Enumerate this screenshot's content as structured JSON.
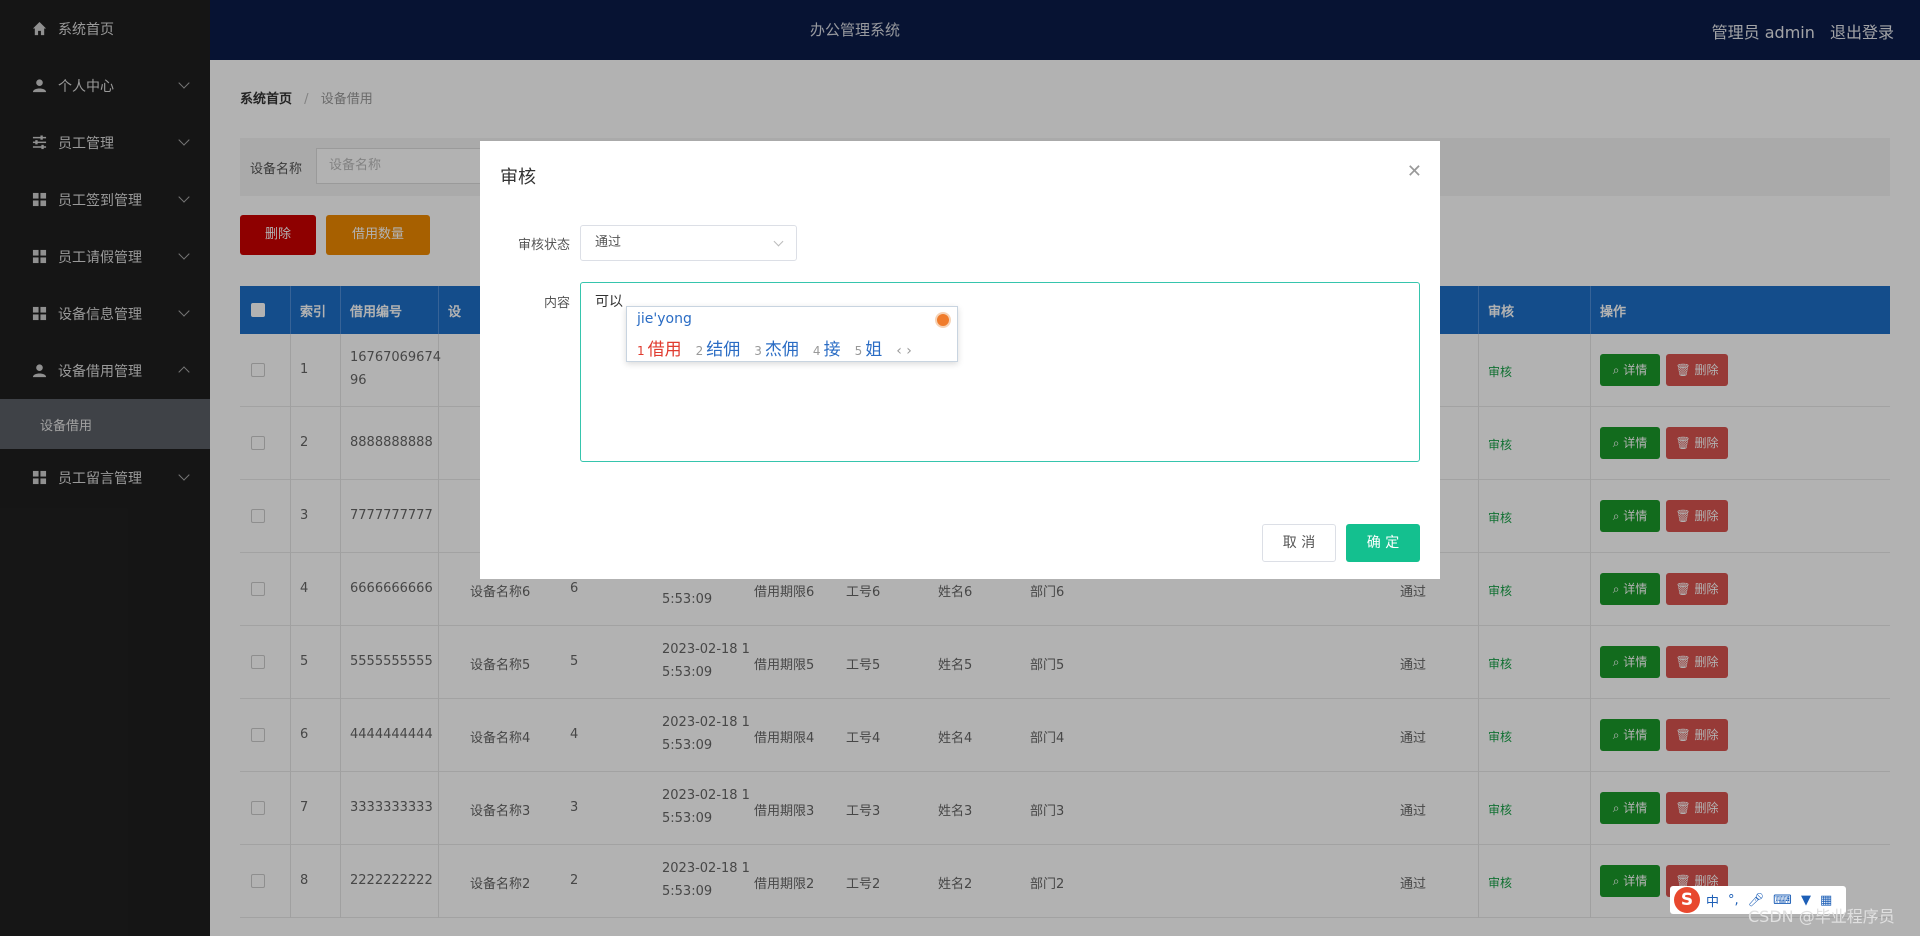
{
  "app": {
    "title": "办公管理系统",
    "user_label": "管理员 admin",
    "logout": "退出登录"
  },
  "sidebar": {
    "items": [
      {
        "label": "系统首页",
        "icon": "home-icon",
        "expand": "none"
      },
      {
        "label": "个人中心",
        "icon": "user-icon",
        "expand": "down"
      },
      {
        "label": "员工管理",
        "icon": "sliders-icon",
        "expand": "down"
      },
      {
        "label": "员工签到管理",
        "icon": "grid-icon",
        "expand": "down"
      },
      {
        "label": "员工请假管理",
        "icon": "grid-icon",
        "expand": "down"
      },
      {
        "label": "设备信息管理",
        "icon": "grid-icon",
        "expand": "down"
      },
      {
        "label": "设备借用管理",
        "icon": "user-icon",
        "expand": "up"
      },
      {
        "label": "员工留言管理",
        "icon": "grid-icon",
        "expand": "down"
      }
    ],
    "sub_active": "设备借用"
  },
  "breadcrumb": {
    "home": "系统首页",
    "current": "设备借用"
  },
  "search": {
    "label": "设备名称",
    "placeholder": "设备名称"
  },
  "toolbar": {
    "delete": "删除",
    "count": "借用数量"
  },
  "table": {
    "headers": [
      "索引",
      "借用编号",
      "设",
      "审核",
      "操作"
    ],
    "detail_label": "详情",
    "delete_label": "删除",
    "audit_label": "审核",
    "rows": [
      {
        "idx": "1",
        "code": "16767069674",
        "code2": "96",
        "name": "",
        "qty": "",
        "date1": "",
        "date2": "",
        "period": "",
        "emp": "",
        "ename": "",
        "dept": "",
        "status": ""
      },
      {
        "idx": "2",
        "code": "8888888888",
        "code2": "",
        "name": "",
        "qty": "",
        "date1": "",
        "date2": "",
        "period": "",
        "emp": "",
        "ename": "",
        "dept": "",
        "status": ""
      },
      {
        "idx": "3",
        "code": "7777777777",
        "code2": "",
        "name": "",
        "qty": "",
        "date1": "",
        "date2": "",
        "period": "",
        "emp": "",
        "ename": "",
        "dept": "",
        "status": ""
      },
      {
        "idx": "4",
        "code": "6666666666",
        "code2": "",
        "name": "设备名称6",
        "qty": "6",
        "date1": "",
        "date2": "5:53:09",
        "period": "借用期限6",
        "emp": "工号6",
        "ename": "姓名6",
        "dept": "部门6",
        "status": "通过"
      },
      {
        "idx": "5",
        "code": "5555555555",
        "code2": "",
        "name": "设备名称5",
        "qty": "5",
        "date1": "2023-02-18 1",
        "date2": "5:53:09",
        "period": "借用期限5",
        "emp": "工号5",
        "ename": "姓名5",
        "dept": "部门5",
        "status": "通过"
      },
      {
        "idx": "6",
        "code": "4444444444",
        "code2": "",
        "name": "设备名称4",
        "qty": "4",
        "date1": "2023-02-18 1",
        "date2": "5:53:09",
        "period": "借用期限4",
        "emp": "工号4",
        "ename": "姓名4",
        "dept": "部门4",
        "status": "通过"
      },
      {
        "idx": "7",
        "code": "3333333333",
        "code2": "",
        "name": "设备名称3",
        "qty": "3",
        "date1": "2023-02-18 1",
        "date2": "5:53:09",
        "period": "借用期限3",
        "emp": "工号3",
        "ename": "姓名3",
        "dept": "部门3",
        "status": "通过"
      },
      {
        "idx": "8",
        "code": "2222222222",
        "code2": "",
        "name": "设备名称2",
        "qty": "2",
        "date1": "2023-02-18 1",
        "date2": "5:53:09",
        "period": "借用期限2",
        "emp": "工号2",
        "ename": "姓名2",
        "dept": "部门2",
        "status": "通过"
      }
    ]
  },
  "dialog": {
    "title": "审核",
    "status_label": "审核状态",
    "status_value": "通过",
    "content_label": "内容",
    "content_value": "可以",
    "cancel": "取 消",
    "ok": "确 定"
  },
  "ime": {
    "pinyin": "jie'yong",
    "candidates": [
      {
        "n": "1",
        "text": "借用"
      },
      {
        "n": "2",
        "text": "结佣"
      },
      {
        "n": "3",
        "text": "杰佣"
      },
      {
        "n": "4",
        "text": "接"
      },
      {
        "n": "5",
        "text": "姐"
      }
    ],
    "nav": "‹ ›",
    "bar_mode": "中",
    "bar_punct": "°,"
  },
  "watermark": "CSDN @毕业程序员"
}
